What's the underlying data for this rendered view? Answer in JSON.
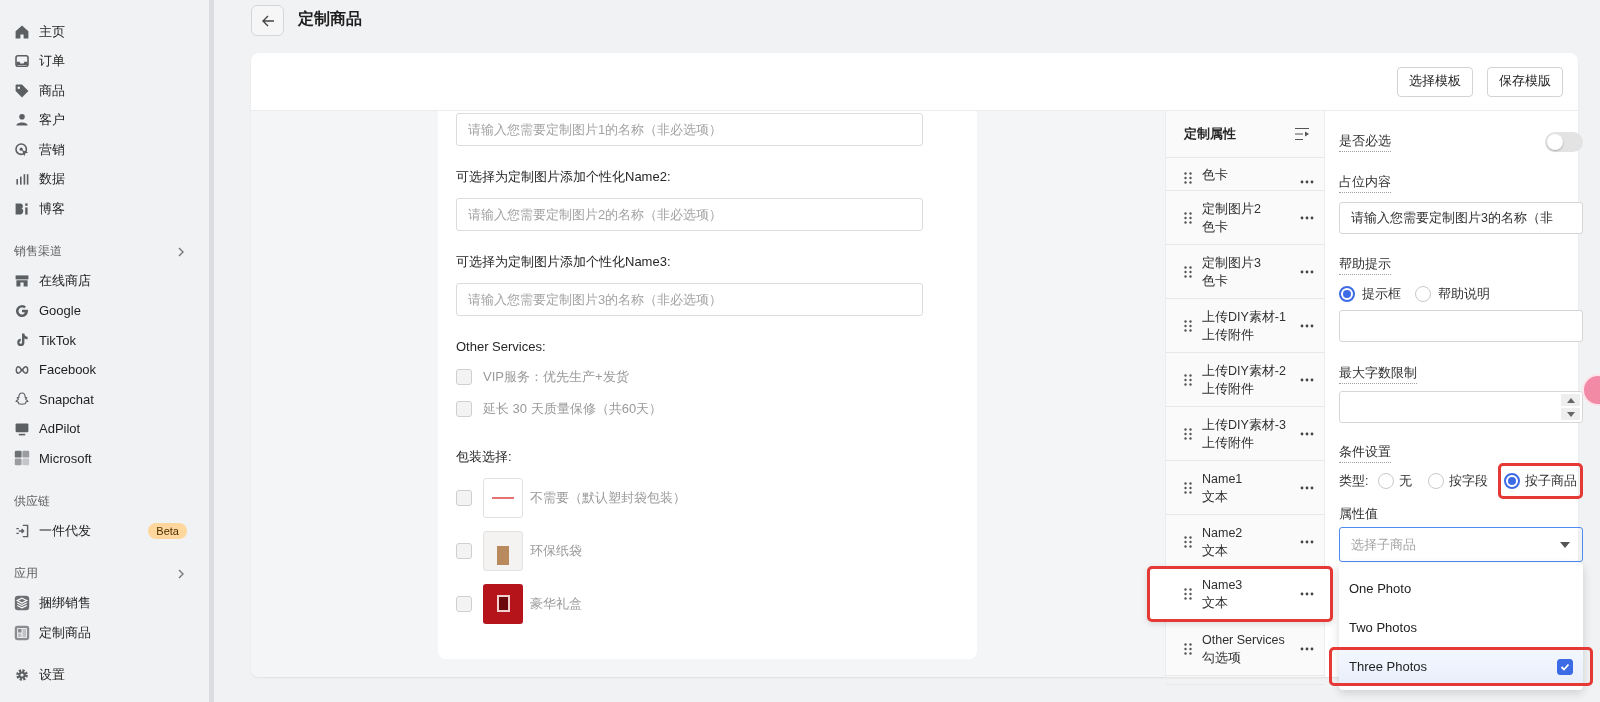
{
  "sidebar": {
    "items": [
      {
        "kind": "nav",
        "label": "主页"
      },
      {
        "kind": "nav",
        "label": "订单"
      },
      {
        "kind": "nav",
        "label": "商品"
      },
      {
        "kind": "nav",
        "label": "客户"
      },
      {
        "kind": "nav",
        "label": "营销"
      },
      {
        "kind": "nav",
        "label": "数据"
      },
      {
        "kind": "nav",
        "label": "博客"
      },
      {
        "kind": "section",
        "label": "销售渠道",
        "expandable": true
      },
      {
        "kind": "nav",
        "label": "在线商店"
      },
      {
        "kind": "nav",
        "label": "Google"
      },
      {
        "kind": "nav",
        "label": "TikTok"
      },
      {
        "kind": "nav",
        "label": "Facebook"
      },
      {
        "kind": "nav",
        "label": "Snapchat"
      },
      {
        "kind": "nav",
        "label": "AdPilot"
      },
      {
        "kind": "nav",
        "label": "Microsoft"
      },
      {
        "kind": "section",
        "label": "供应链",
        "expandable": false
      },
      {
        "kind": "nav",
        "label": "一件代发",
        "badge": "Beta"
      },
      {
        "kind": "section",
        "label": "应用",
        "expandable": true
      },
      {
        "kind": "nav",
        "label": "捆绑销售"
      },
      {
        "kind": "nav",
        "label": "定制商品"
      },
      {
        "kind": "nav",
        "label": "设置"
      }
    ]
  },
  "header": {
    "title": "定制商品"
  },
  "toolbar": {
    "buttons": [
      "选择模板",
      "保存模版"
    ]
  },
  "preview": {
    "fields": [
      {
        "placeholder": "请输入您需要定制图片1的名称（非必选项）"
      },
      {
        "label": "可选择为定制图片添加个性化Name2:",
        "placeholder": "请输入您需要定制图片2的名称（非必选项）"
      },
      {
        "label": "可选择为定制图片添加个性化Name3:",
        "placeholder": "请输入您需要定制图片3的名称（非必选项）"
      }
    ],
    "services": {
      "title": "Other Services:",
      "options": [
        {
          "label": "VIP服务：优先生产+发货",
          "checked": false
        },
        {
          "label": "延长 30 天质量保修（共60天）",
          "checked": false
        }
      ]
    },
    "packaging": {
      "title": "包装选择:",
      "options": [
        {
          "label": "不需要（默认塑封袋包装）",
          "checked": false
        },
        {
          "label": "环保纸袋",
          "checked": false
        },
        {
          "label": "豪华礼盒",
          "checked": false
        }
      ]
    }
  },
  "properties": {
    "title": "定制属性",
    "items": [
      {
        "type": "色卡",
        "highlighted": false
      },
      {
        "name": "定制图片2",
        "type": "色卡",
        "highlighted": false
      },
      {
        "name": "定制图片3",
        "type": "色卡",
        "highlighted": false
      },
      {
        "name": "上传DIY素材-1",
        "type": "上传附件",
        "highlighted": false
      },
      {
        "name": "上传DIY素材-2",
        "type": "上传附件",
        "highlighted": false
      },
      {
        "name": "上传DIY素材-3",
        "type": "上传附件",
        "highlighted": false
      },
      {
        "name": "Name1",
        "type": "文本",
        "highlighted": false
      },
      {
        "name": "Name2",
        "type": "文本",
        "highlighted": false
      },
      {
        "name": "Name3",
        "type": "文本",
        "highlighted": true
      },
      {
        "name": "Other Services",
        "type": "勾选项",
        "highlighted": false
      }
    ]
  },
  "settings": {
    "required": {
      "label": "是否必选",
      "on": false
    },
    "placeholder_content": {
      "label": "占位内容",
      "value": "请输入您需要定制图片3的名称（非"
    },
    "help": {
      "label": "帮助提示",
      "options": [
        {
          "label": "提示框",
          "selected": true
        },
        {
          "label": "帮助说明",
          "selected": false
        }
      ]
    },
    "max_length": {
      "label": "最大字数限制"
    },
    "condition": {
      "label": "条件设置",
      "type_label": "类型:",
      "options": [
        {
          "label": "无",
          "selected": false,
          "highlighted": false
        },
        {
          "label": "按字段",
          "selected": false,
          "highlighted": false
        },
        {
          "label": "按子商品",
          "selected": true,
          "highlighted": true
        }
      ]
    },
    "attribute": {
      "label": "属性值",
      "placeholder": "选择子商品",
      "options": [
        {
          "label": "One Photo",
          "selected": false,
          "highlighted": false
        },
        {
          "label": "Two Photos",
          "selected": false,
          "highlighted": false
        },
        {
          "label": "Three Photos",
          "selected": true,
          "highlighted": true
        }
      ]
    }
  }
}
